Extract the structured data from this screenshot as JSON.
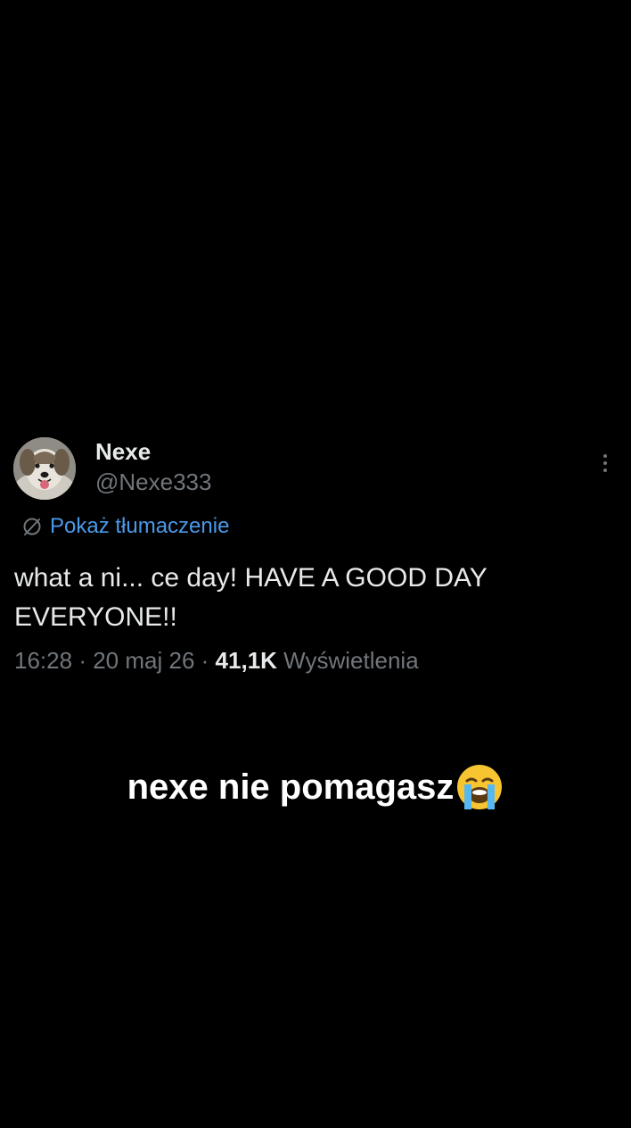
{
  "tweet": {
    "author": {
      "display_name": "Nexe",
      "handle": "@Nexe333",
      "avatar_icon": "dog-avatar"
    },
    "more_icon": "more-vertical-icon",
    "translate": {
      "icon": "globe-slash-icon",
      "label": "Pokaż tłumaczenie"
    },
    "text": "what a ni... ce day! HAVE A GOOD DAY EVERYONE!!",
    "time": "16:28",
    "date": "20 maj 26",
    "views_count": "41,1K",
    "views_label": "Wyświetlenia",
    "separator": "·"
  },
  "caption": {
    "text": "nexe nie pomagasz",
    "emoji_icon": "loudly-crying-face-icon"
  },
  "colors": {
    "background": "#000000",
    "primary_text": "#e7e9ea",
    "secondary_text": "#71767b",
    "link": "#4a99e9"
  }
}
